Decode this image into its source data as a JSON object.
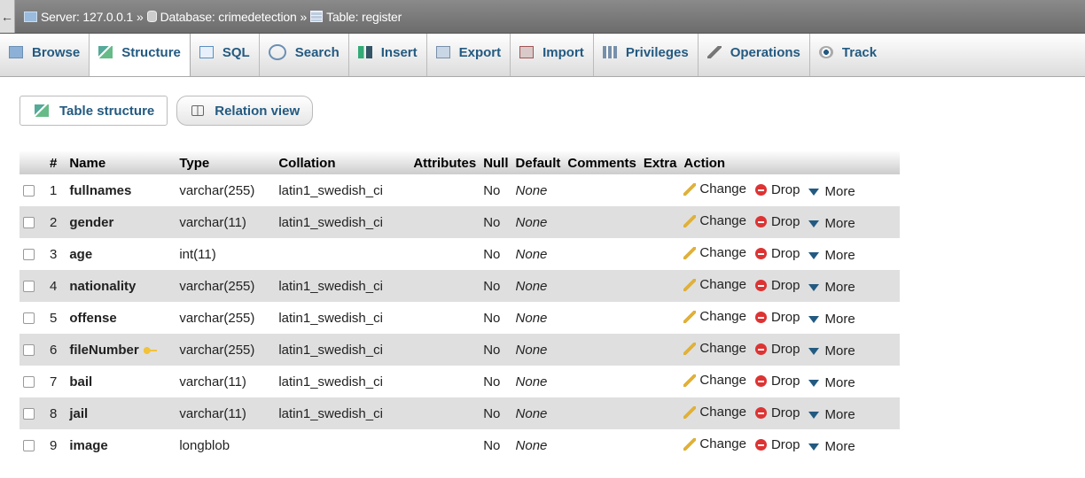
{
  "breadcrumb": {
    "back": "←",
    "server": "Server: 127.0.0.1",
    "sep1": "»",
    "database": "Database: crimedetection",
    "sep2": "»",
    "table": "Table: register"
  },
  "tabs": [
    {
      "label": "Browse"
    },
    {
      "label": "Structure"
    },
    {
      "label": "SQL"
    },
    {
      "label": "Search"
    },
    {
      "label": "Insert"
    },
    {
      "label": "Export"
    },
    {
      "label": "Import"
    },
    {
      "label": "Privileges"
    },
    {
      "label": "Operations"
    },
    {
      "label": "Track"
    }
  ],
  "subbuttons": {
    "table_structure": "Table structure",
    "relation_view": "Relation view"
  },
  "columns": {
    "num": "#",
    "name": "Name",
    "type": "Type",
    "collation": "Collation",
    "attributes": "Attributes",
    "null": "Null",
    "default": "Default",
    "comments": "Comments",
    "extra": "Extra",
    "action": "Action"
  },
  "actions": {
    "change": "Change",
    "drop": "Drop",
    "more": "More"
  },
  "rows": [
    {
      "num": "1",
      "name": "fullnames",
      "type": "varchar(255)",
      "collation": "latin1_swedish_ci",
      "null": "No",
      "default": "None"
    },
    {
      "num": "2",
      "name": "gender",
      "type": "varchar(11)",
      "collation": "latin1_swedish_ci",
      "null": "No",
      "default": "None"
    },
    {
      "num": "3",
      "name": "age",
      "type": "int(11)",
      "collation": "",
      "null": "No",
      "default": "None"
    },
    {
      "num": "4",
      "name": "nationality",
      "type": "varchar(255)",
      "collation": "latin1_swedish_ci",
      "null": "No",
      "default": "None"
    },
    {
      "num": "5",
      "name": "offense",
      "type": "varchar(255)",
      "collation": "latin1_swedish_ci",
      "null": "No",
      "default": "None"
    },
    {
      "num": "6",
      "name": "fileNumber",
      "type": "varchar(255)",
      "collation": "latin1_swedish_ci",
      "null": "No",
      "default": "None",
      "key": true
    },
    {
      "num": "7",
      "name": "bail",
      "type": "varchar(11)",
      "collation": "latin1_swedish_ci",
      "null": "No",
      "default": "None"
    },
    {
      "num": "8",
      "name": "jail",
      "type": "varchar(11)",
      "collation": "latin1_swedish_ci",
      "null": "No",
      "default": "None"
    },
    {
      "num": "9",
      "name": "image",
      "type": "longblob",
      "collation": "",
      "null": "No",
      "default": "None"
    }
  ]
}
